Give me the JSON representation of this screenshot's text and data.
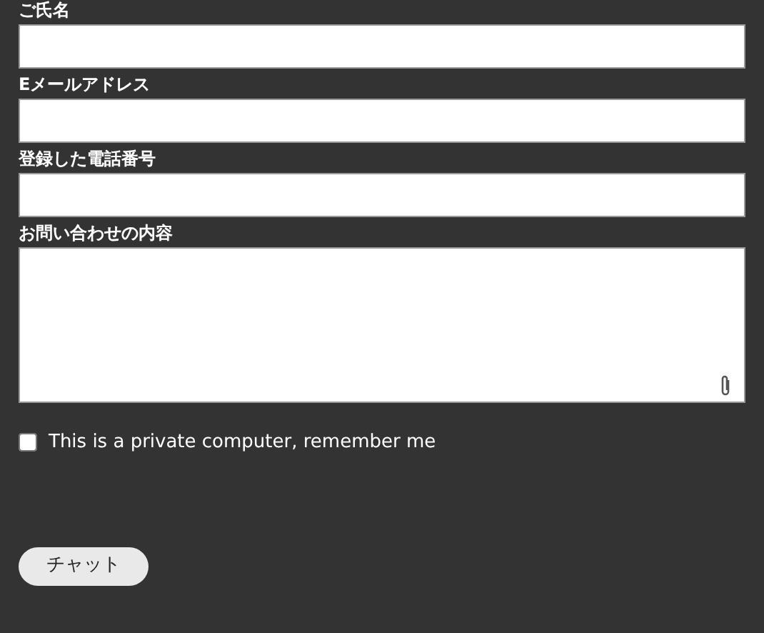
{
  "fields": [
    {
      "label": "ご氏名",
      "kind": "text"
    },
    {
      "label": "Eメールアドレス",
      "kind": "text"
    },
    {
      "label": "登録した電話番号",
      "kind": "text"
    },
    {
      "label": "お問い合わせの内容",
      "kind": "textarea"
    }
  ],
  "remember": {
    "label": "This is a private computer, remember me",
    "checked": false
  },
  "submit": "チャット"
}
